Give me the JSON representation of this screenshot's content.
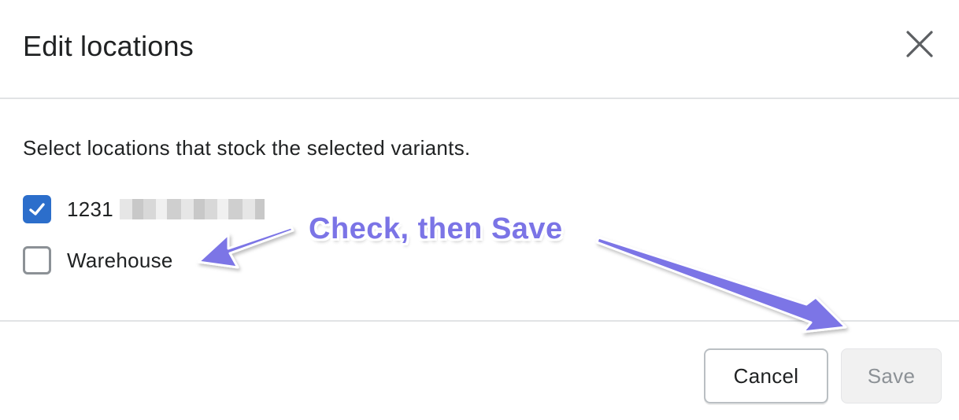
{
  "dialog": {
    "title": "Edit locations",
    "description": "Select locations that stock the selected variants.",
    "close_icon": "close-icon"
  },
  "locations": [
    {
      "label": "1231",
      "checked": true,
      "redacted_suffix": true
    },
    {
      "label": "Warehouse",
      "checked": false
    }
  ],
  "footer": {
    "cancel_label": "Cancel",
    "save_label": "Save",
    "save_disabled": true
  },
  "annotation": {
    "text": "Check, then Save",
    "color": "#7b74e6"
  },
  "colors": {
    "checkbox_checked": "#2c6ecb",
    "divider": "#e1e3e5"
  }
}
